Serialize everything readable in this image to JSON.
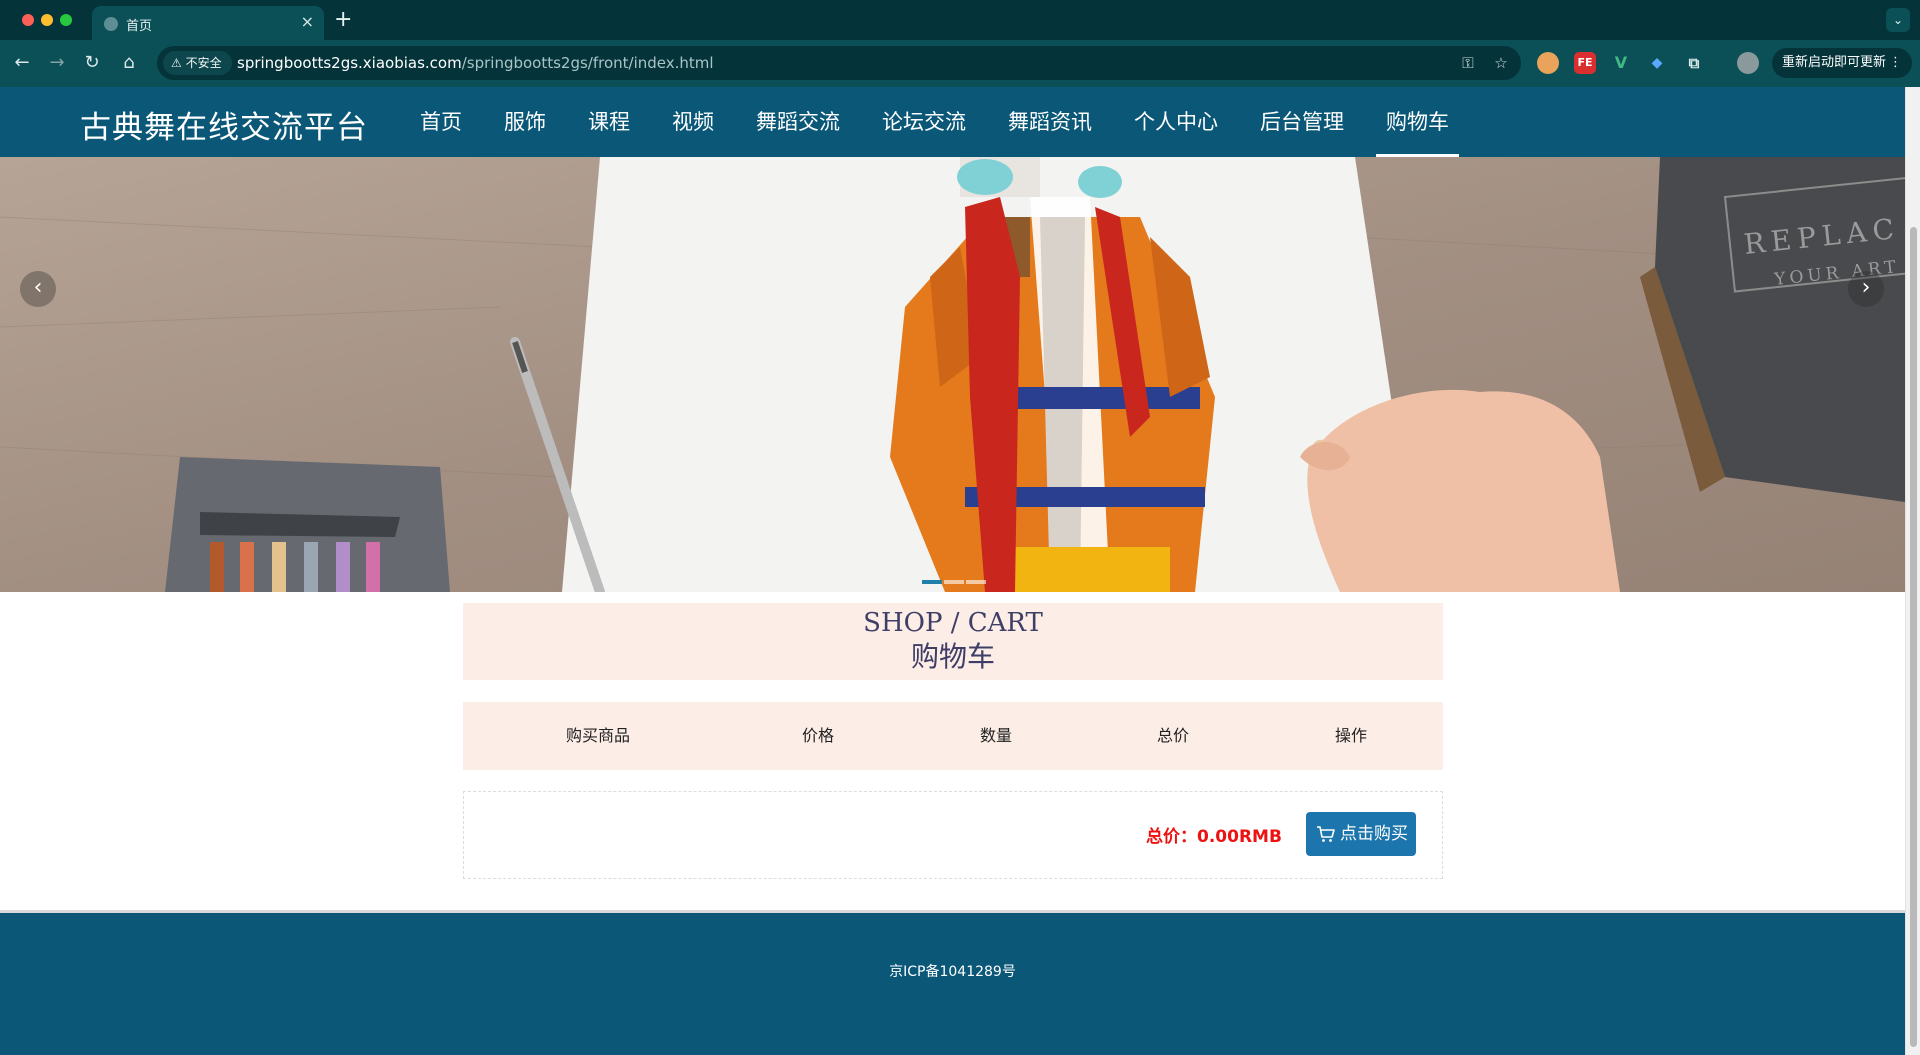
{
  "browser": {
    "tab_title": "首页",
    "tab_close": "×",
    "new_tab": "+",
    "insecure_label": "不安全",
    "url_host": "springbootts2gs.xiaobias.com",
    "url_path": "/springbootts2gs/front/index.html",
    "restart_label": "重新启动即可更新",
    "extensions": [
      "FE",
      "V"
    ],
    "icons": [
      "back-icon",
      "forward-icon",
      "reload-icon",
      "home-icon",
      "key-icon",
      "star-icon",
      "puzzle-icon",
      "more-icon"
    ]
  },
  "site": {
    "title": "古典舞在线交流平台",
    "menu": [
      {
        "label": "首页",
        "active": false
      },
      {
        "label": "服饰",
        "active": false
      },
      {
        "label": "课程",
        "active": false
      },
      {
        "label": "视频",
        "active": false
      },
      {
        "label": "舞蹈交流",
        "active": false
      },
      {
        "label": "论坛交流",
        "active": false
      },
      {
        "label": "舞蹈资讯",
        "active": false
      },
      {
        "label": "个人中心",
        "active": false
      },
      {
        "label": "后台管理",
        "active": false
      },
      {
        "label": "购物车",
        "active": true
      }
    ]
  },
  "banner": {
    "book_text_1": "REPLAC",
    "book_text_2": "YOUR ART",
    "slide_count": 3,
    "active_slide": 1
  },
  "cart": {
    "title_en": "SHOP / CART",
    "title_cn": "购物车",
    "columns": [
      "购买商品",
      "价格",
      "数量",
      "总价",
      "操作"
    ],
    "total_label": "总价：",
    "total_value": "0.00RMB",
    "buy_button": "点击购买"
  },
  "footer": {
    "icp": "京ICP备1041289号"
  },
  "colors": {
    "header_bg": "#0a5778",
    "cart_panel_bg": "#fcede6",
    "total_text": "#ee1111",
    "buy_button_bg": "#1c76ad",
    "chrome_bg": "#04343a"
  }
}
